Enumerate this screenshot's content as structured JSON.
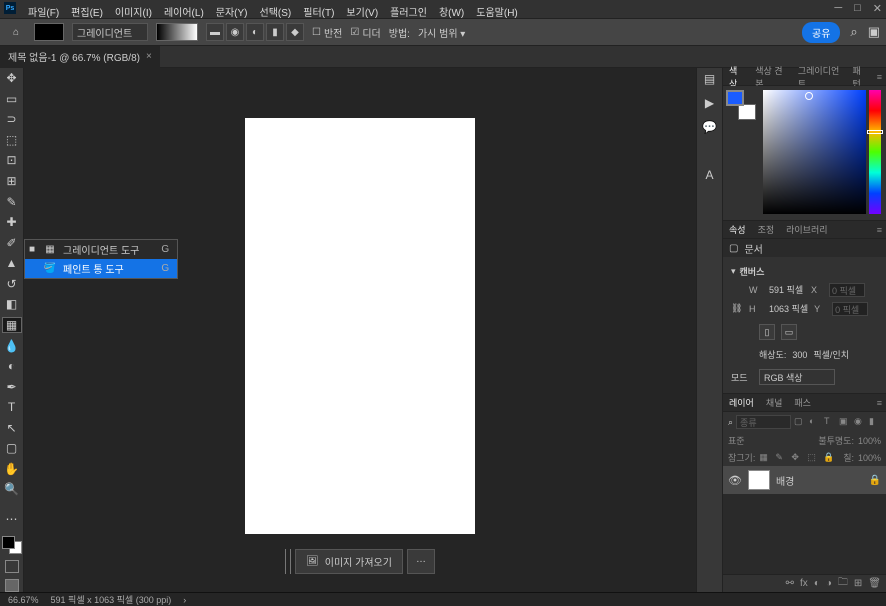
{
  "titlebar": {
    "app": "Ps"
  },
  "menubar": [
    "파일(F)",
    "편집(E)",
    "이미지(I)",
    "레이어(L)",
    "문자(Y)",
    "선택(S)",
    "필터(T)",
    "보기(V)",
    "플러그인",
    "창(W)",
    "도움말(H)"
  ],
  "options": {
    "preset_label": "그레이디언트",
    "reverse": "반전",
    "dither": "디더",
    "method": "방법:",
    "method_value": "가시 범위",
    "share": "공유"
  },
  "tab": {
    "title": "제목 없음-1 @ 66.7% (RGB/8)"
  },
  "flyout": {
    "items": [
      {
        "label": "그레이디언트 도구",
        "shortcut": "G"
      },
      {
        "label": "페인트 통 도구",
        "shortcut": "G"
      }
    ]
  },
  "import_button": "이미지 가져오기",
  "more_button": "…",
  "panels": {
    "color_tabs": [
      "색상",
      "색상 견본",
      "그레이디언트",
      "패턴"
    ],
    "props_tabs": [
      "속성",
      "조정",
      "라이브러리"
    ],
    "doc_label": "문서",
    "canvas_label": "캔버스",
    "w_label": "W",
    "w_val": "591",
    "w_unit": "픽셀",
    "x_label": "X",
    "x_ph": "0 픽셀",
    "h_label": "H",
    "h_val": "1063",
    "h_unit": "픽셀",
    "y_label": "Y",
    "y_ph": "0 픽셀",
    "res_label": "해상도:",
    "res_val": "300",
    "res_unit": "픽셀/인치",
    "mode_label": "모드",
    "mode_val": "RGB 색상",
    "layers_tabs": [
      "레이어",
      "채널",
      "패스"
    ],
    "layers_search": "종류",
    "blend_label": "표준",
    "opacity_label": "불투명도:",
    "opacity_val": "100%",
    "lock_label": "잠그기:",
    "fill_label": "칠:",
    "fill_val": "100%",
    "layer_name": "배경"
  },
  "status": {
    "zoom": "66.67%",
    "info": "591 픽셀 x 1063 픽셀 (300 ppi)"
  }
}
